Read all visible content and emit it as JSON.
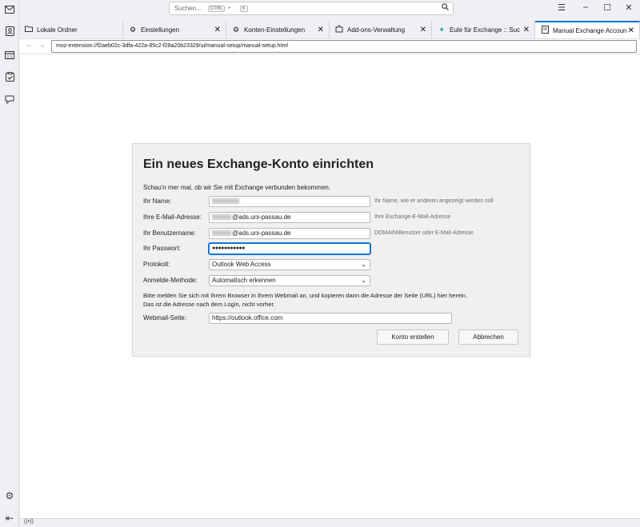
{
  "spaces": {
    "icons": [
      "mail-icon",
      "address-book-icon",
      "calendar-icon",
      "tasks-icon",
      "chat-icon"
    ],
    "bottom_icons": [
      "settings-gear-icon",
      "collapse-sidebar-icon"
    ]
  },
  "search": {
    "placeholder": "Suchen...",
    "shortcut_key": "CTRL",
    "shortcut_plus": "+",
    "shortcut_letter": "K"
  },
  "tabs": [
    {
      "label": "Lokale Ordner",
      "icon": "folder-icon",
      "active": false,
      "closable": false
    },
    {
      "label": "Einstellungen",
      "icon": "gear-icon",
      "active": false,
      "closable": true
    },
    {
      "label": "Konten-Einstellungen",
      "icon": "gear-icon",
      "active": false,
      "closable": true
    },
    {
      "label": "Add-ons-Verwaltung",
      "icon": "puzzle-icon",
      "active": false,
      "closable": true
    },
    {
      "label": "Eule für Exchange :: Suche",
      "icon": "owl-icon",
      "active": false,
      "closable": true
    },
    {
      "label": "Manual Exchange Account",
      "icon": "page-icon",
      "active": true,
      "closable": true
    }
  ],
  "url": "moz-extension://f2aeb02c-3dfa-422a-85c2-f28a20b23329/ui/manual-setup/manual-setup.html",
  "dialog": {
    "title": "Ein neues Exchange-Konto einrichten",
    "intro": "Schau'n mer mal, ob wir Sie mit Exchange verbunden bekommen.",
    "name_label": "Ihr Name:",
    "name_hint": "Ihr Name, wie er anderen angezeigt werden soll",
    "email_label": "Ihre E-Mail-Adresse:",
    "email_domain": "@ads.uni-passau.de",
    "email_hint": "Ihre Exchange-E-Mail-Adresse",
    "username_label": "Ihr Benutzername:",
    "username_domain": "@ads.uni-passau.de",
    "username_hint": "DOMAIN\\Benutzer oder E-Mail-Adresse",
    "password_label": "Ihr Passwort:",
    "password_value": "●●●●●●●●●●●",
    "protocol_label": "Protokoll:",
    "protocol_value": "Outlook Web Access",
    "login_label": "Anmelde-Methode:",
    "login_value": "Automatisch erkennen",
    "info_line1": "Bitte melden Sie sich mit Ihrem Browser in Ihrem Webmail an, und kopieren dann die Adresse der Seite (URL) hier herein.",
    "info_line2": "Das ist die Adresse nach dem Login, nicht vorher.",
    "webmail_label": "Webmail-Seite:",
    "webmail_value": "https://outlook.office.com",
    "create_button": "Konto erstellen",
    "cancel_button": "Abbrechen"
  },
  "colors": {
    "accent": "#1373d9",
    "dialog_bg": "#f0f0f0",
    "chrome_bg": "#f0f0f4"
  }
}
